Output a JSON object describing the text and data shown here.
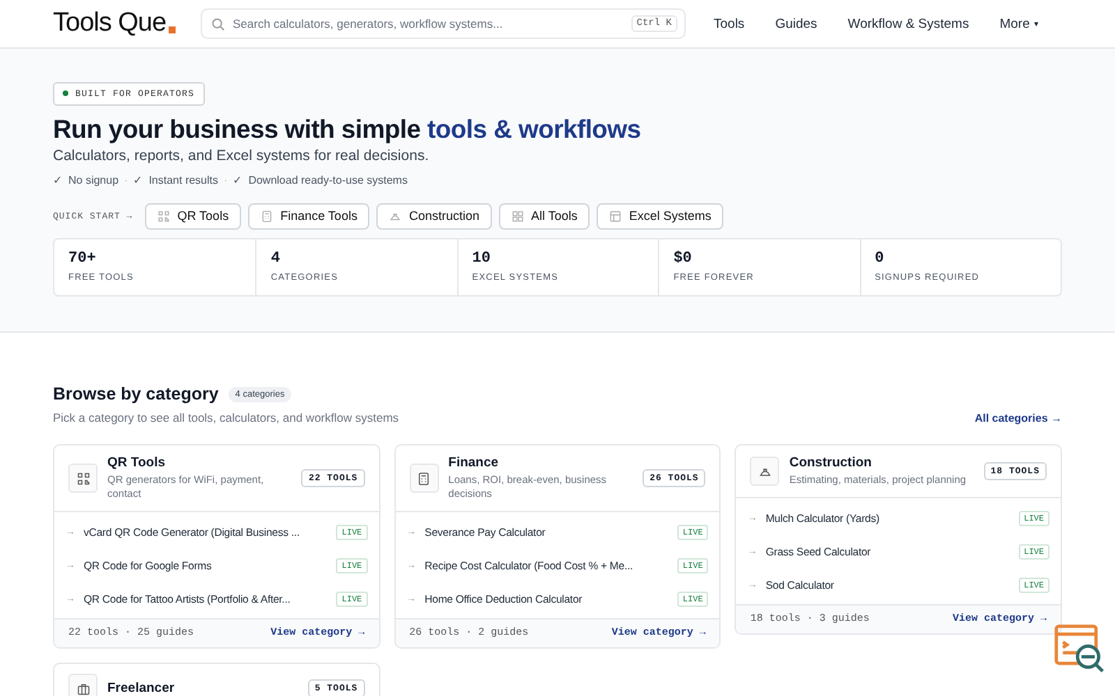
{
  "header": {
    "logo": "Tools Que",
    "search": {
      "placeholder": "Search calculators, generators, workflow systems...",
      "shortcut": "Ctrl K"
    },
    "nav": [
      {
        "label": "Tools",
        "kind": "link"
      },
      {
        "label": "Guides",
        "kind": "link"
      },
      {
        "label": "Workflow & Systems",
        "kind": "link"
      },
      {
        "label": "More",
        "kind": "menu",
        "caret": "▾"
      }
    ]
  },
  "hero": {
    "badge": "BUILT FOR OPERATORS",
    "title": "Run your business with simple **tools & workflows**",
    "subtitle": "Calculators, reports, and Excel systems for real decisions.",
    "checks": [
      {
        "mark": "✓",
        "label": "No signup"
      },
      {
        "separator": "·",
        "mark": "✓",
        "label": "Instant results"
      },
      {
        "separator": "·",
        "mark": "✓",
        "label": "Download ready-to-use systems"
      }
    ],
    "quick_start_label": "QUICK START →",
    "quick_links": [
      {
        "label": "QR Tools",
        "kind": "qr"
      },
      {
        "label": "Finance Tools",
        "kind": "calculator"
      },
      {
        "label": "Construction",
        "kind": "construction"
      },
      {
        "label": "All Tools",
        "kind": "catalog"
      },
      {
        "label": "Excel Systems",
        "kind": "spreadsheet"
      }
    ],
    "stats": [
      {
        "value": "70+",
        "label": "FREE TOOLS"
      },
      {
        "value": "4",
        "label": "CATEGORIES"
      },
      {
        "value": "10",
        "label": "EXCEL SYSTEMS"
      },
      {
        "value": "$0",
        "label": "FREE FOREVER"
      },
      {
        "value": "0",
        "label": "SIGNUPS REQUIRED"
      }
    ]
  },
  "browse": {
    "title": "Browse by category",
    "count": "4 categories",
    "subtitle": "Pick a category to see all tools, calculators, and workflow systems",
    "all_link": "All categories →",
    "categories": [
      {
        "name": "QR Tools",
        "kind": "qr",
        "description": "QR generators for WiFi, payment, contact",
        "badge": "22 TOOLS",
        "tools": [
          {
            "arrow": "→",
            "name": "vCard QR Code Generator (Digital Business ...",
            "status": "LIVE"
          },
          {
            "arrow": "→",
            "name": "QR Code for Google Forms",
            "status": "LIVE"
          },
          {
            "arrow": "→",
            "name": "QR Code for Tattoo Artists (Portfolio & After...",
            "status": "LIVE"
          }
        ],
        "footer": "22 tools · 25 guides",
        "link": "View category →"
      },
      {
        "name": "Finance",
        "kind": "calculator",
        "description": "Loans, ROI, break-even, business decisions",
        "badge": "26 TOOLS",
        "tools": [
          {
            "arrow": "→",
            "name": "Severance Pay Calculator",
            "status": "LIVE"
          },
          {
            "arrow": "→",
            "name": "Recipe Cost Calculator (Food Cost % + Me...",
            "status": "LIVE"
          },
          {
            "arrow": "→",
            "name": "Home Office Deduction Calculator",
            "status": "LIVE"
          }
        ],
        "footer": "26 tools · 2 guides",
        "link": "View category →"
      },
      {
        "name": "Construction",
        "kind": "construction",
        "description": "Estimating, materials, project planning",
        "badge": "18 TOOLS",
        "tools": [
          {
            "arrow": "→",
            "name": "Mulch Calculator (Yards)",
            "status": "LIVE"
          },
          {
            "arrow": "→",
            "name": "Grass Seed Calculator",
            "status": "LIVE"
          },
          {
            "arrow": "→",
            "name": "Sod Calculator",
            "status": "LIVE"
          }
        ],
        "footer": "18 tools · 3 guides",
        "link": "View category →"
      },
      {
        "name": "Freelancer",
        "kind": "freelance",
        "badge": "5 TOOLS"
      }
    ]
  }
}
